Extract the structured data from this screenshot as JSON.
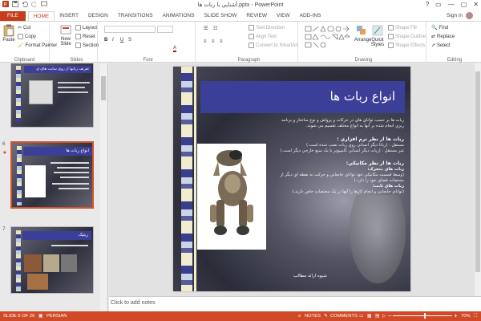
{
  "window": {
    "title": "ﺁشنايي با ربات ها.pptx - PowerPoint",
    "controls": [
      "?",
      "▭",
      "—",
      "▢",
      "✕"
    ]
  },
  "tabs": [
    "FILE",
    "HOME",
    "INSERT",
    "DESIGN",
    "TRANSITIONS",
    "ANIMATIONS",
    "SLIDE SHOW",
    "REVIEW",
    "VIEW",
    "ADD-INS"
  ],
  "signin": "Sign in",
  "ribbon": {
    "clipboard": {
      "label": "Clipboard",
      "paste": "Paste",
      "cut": "Cut",
      "copy": "Copy",
      "format_painter": "Format Painter"
    },
    "slides": {
      "label": "Slides",
      "new_slide": "New Slide",
      "layout": "Layout",
      "reset": "Reset",
      "section": "Section"
    },
    "font": {
      "label": "Font"
    },
    "paragraph": {
      "label": "Paragraph",
      "text_direction": "Text Direction",
      "align_text": "Align Text",
      "convert_smartart": "Convert to SmartArt"
    },
    "drawing": {
      "label": "Drawing",
      "arrange": "Arrange",
      "quick_styles": "Quick Styles",
      "shape_fill": "Shape Fill",
      "shape_outline": "Shape Outline",
      "shape_effects": "Shape Effects"
    },
    "editing": {
      "label": "Editing",
      "find": "Find",
      "replace": "Replace",
      "select": "Select"
    }
  },
  "thumbnails": [
    {
      "number": "",
      "title": "تعريف رباتها از روي سايت هاي ي"
    },
    {
      "number": "6",
      "title": "انواع ربات ها"
    },
    {
      "number": "7",
      "title": "ربتيک"
    }
  ],
  "slide": {
    "title": "انواع ربات ها",
    "intro": [
      "ربات ها بر حسب تواناي هاي در حرکات و پرواش و نوع ساختار و برنامه",
      "ريزي انجام شده بر آنها به انواع مختلف تقسيم مي شوند."
    ],
    "section1": {
      "heading": "ربات ها از نظر نرم افزاري :",
      "items": [
        "مستقل : (رباتا ديگر انساني روي ربات نصب شده است.)",
        "غير مستقل : (ربات ديگر انساني کامپيوتر يا يک منبع خارجي ديگر است.)"
      ]
    },
    "section2": {
      "heading": "ربات ها از نظر مکانيکي:",
      "sub1": "ربات هاي متحرک:",
      "sub1_text": "(وسط قسمت مکانيکي خود تواناي جابجايي و حرکت به نقطه اي ديگر از محتصات فضاي خود را دارد.)",
      "sub2": "ربات هاي ثابت:",
      "sub2_text": "(تواناي جابجايي و انجام کارها را آنها در يک محتصات خاص دارند.)"
    },
    "footer": "شيوه ارائه مطالب"
  },
  "notes_placeholder": "Click to add notes",
  "status": {
    "slide_of": "SLIDE 6 OF 26",
    "language": "PERSIAN",
    "notes": "NOTES",
    "comments": "COMMENTS",
    "zoom": "70%"
  },
  "colors": {
    "accent": "#c43e1c",
    "status_bar": "#d04a27",
    "slide_title_band": "#3c3f98"
  }
}
